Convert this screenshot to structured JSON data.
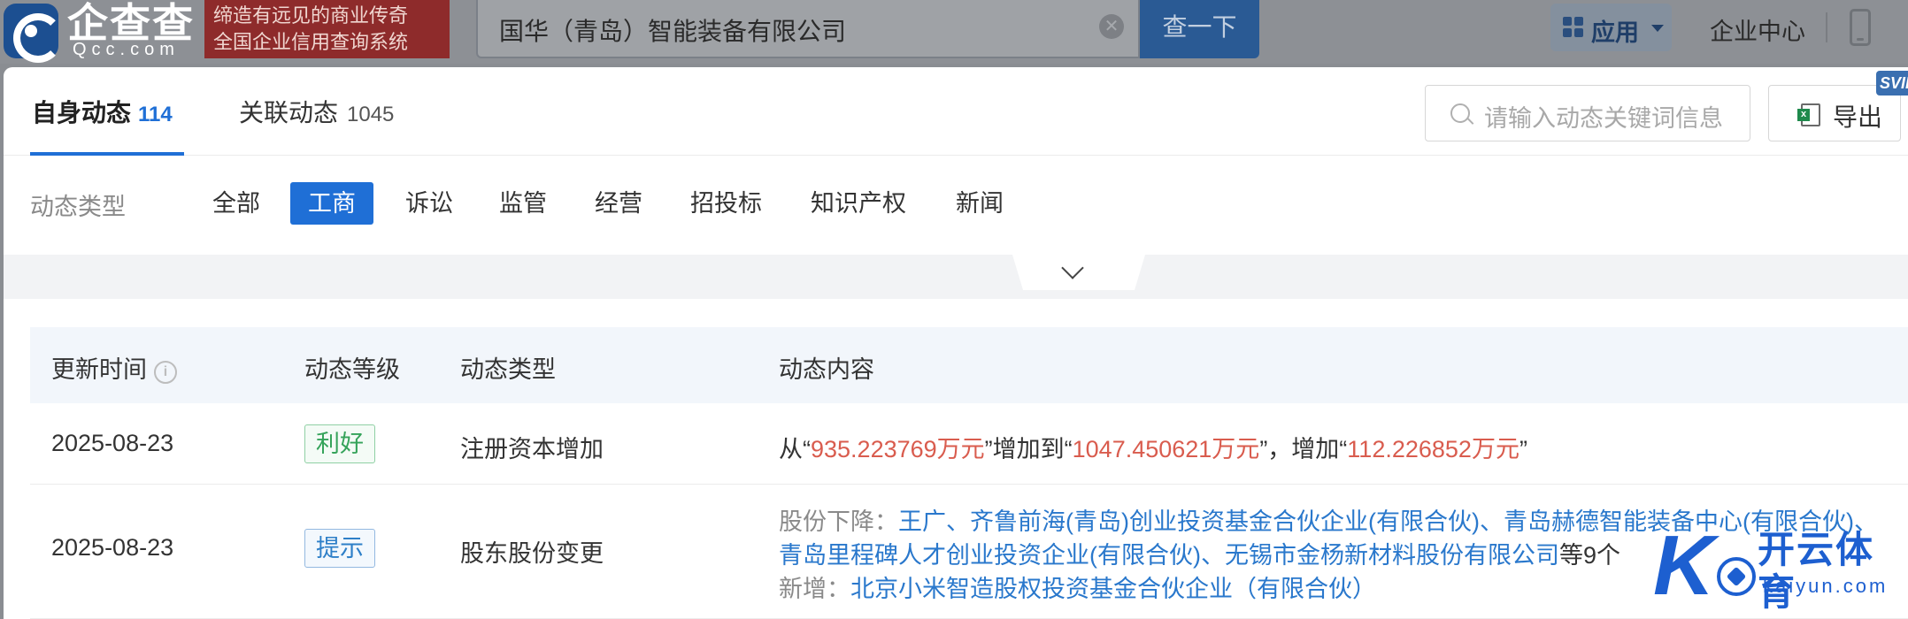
{
  "header": {
    "logo_text": "企查查",
    "logo_url": "Qcc.com",
    "slogan_line1": "缔造有远见的商业传奇",
    "slogan_line2": "全国企业信用查询系统",
    "search_value": "国华（青岛）智能装备有限公司",
    "search_button": "查一下",
    "app_label": "应用",
    "corp_center": "企业中心"
  },
  "tabs": {
    "own": {
      "label": "自身动态",
      "count": "114"
    },
    "related": {
      "label": "关联动态",
      "count": "1045"
    },
    "keyword_placeholder": "请输入动态关键词信息",
    "export_label": "导出",
    "svip": "SVIP"
  },
  "filters": {
    "label": "动态类型",
    "items": [
      "全部",
      "工商",
      "诉讼",
      "监管",
      "经营",
      "招投标",
      "知识产权",
      "新闻"
    ],
    "active": "工商"
  },
  "table": {
    "headers": [
      "更新时间",
      "动态等级",
      "动态类型",
      "动态内容"
    ],
    "rows": [
      {
        "date": "2025-08-23",
        "level": "利好",
        "type": "注册资本增加",
        "content": {
          "p1": "从“",
          "from": "935.223769万元",
          "p2": "”增加到“",
          "to": "1047.450621万元",
          "p3": "”，增加“",
          "delta": "112.226852万元",
          "p4": "”"
        }
      },
      {
        "date": "2025-08-23",
        "level": "提示",
        "type": "股东股份变更",
        "content": {
          "decrease_label": "股份下降：",
          "decrease_line1": "王广、齐鲁前海(青岛)创业投资基金合伙企业(有限合伙)、青岛赫德智能装备中心(有限合伙)、",
          "decrease_line2": "青岛里程碑人才创业投资企业(有限合伙)、无锡市金杨新材料股份有限公司",
          "decrease_more": "等9个",
          "add_label": "新增：",
          "add_value": "北京小米智造股权投资基金合伙企业（有限合伙）"
        }
      }
    ]
  },
  "watermark": {
    "cn": "开云体育",
    "en": "kaiyun.com",
    "k": "K"
  },
  "colors": {
    "primary": "#1f6fd6",
    "red": "#d95c4e",
    "good": "#35a35a",
    "link": "#2a78cc"
  }
}
